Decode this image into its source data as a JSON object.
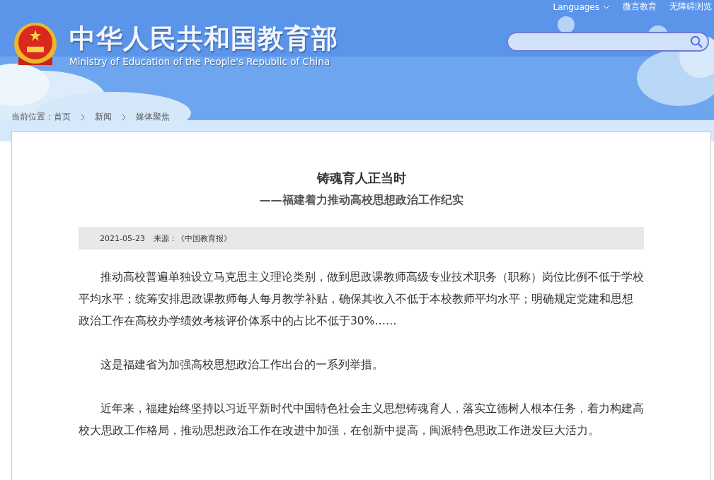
{
  "top_links": [
    {
      "label": "Languages",
      "dropdown": true
    },
    {
      "label": "微言教育",
      "dropdown": false
    },
    {
      "label": "无障碍浏览",
      "dropdown": false
    }
  ],
  "site": {
    "title": "中华人民共和国教育部",
    "subtitle": "Ministry of Education of the People's Republic of China"
  },
  "breadcrumb": {
    "prefix": "当前位置：",
    "items": [
      "首页",
      "新闻",
      "媒体聚焦"
    ]
  },
  "article": {
    "title": "铸魂育人正当时",
    "subtitle": "——福建着力推动高校思想政治工作纪实",
    "date": "2021-05-23",
    "source": "来源：《中国教育报》",
    "paragraphs": [
      "推动高校普遍单独设立马克思主义理论类别，做到思政课教师高级专业技术职务（职称）岗位比例不低于学校平均水平；统筹安排思政课教师每人每月教学补贴，确保其收入不低于本校教师平均水平；明确规定党建和思想政治工作在高校办学绩效考核评价体系中的占比不低于30%……",
      "这是福建省为加强高校思想政治工作出台的一系列举措。",
      "近年来，福建始终坚持以习近平新时代中国特色社会主义思想铸魂育人，落实立德树人根本任务，着力构建高校大思政工作格局，推动思想政治工作在改进中加强，在创新中提高，闽派特色思政工作迸发巨大活力。"
    ]
  }
}
